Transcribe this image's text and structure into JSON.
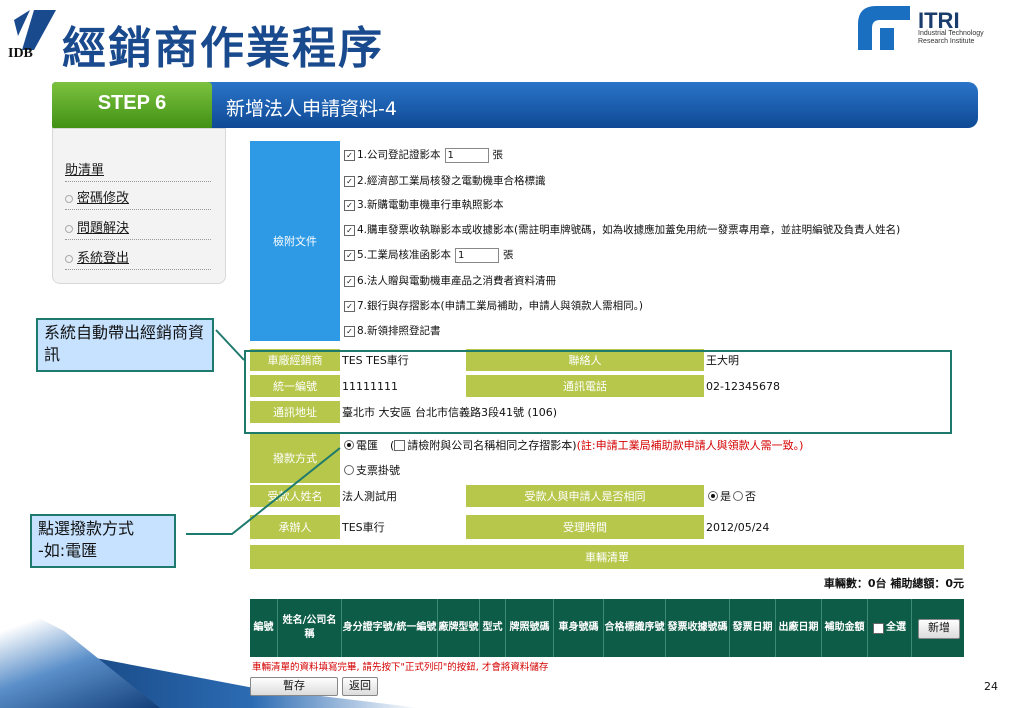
{
  "header": {
    "logo_text": "IDB",
    "title": "經銷商作業程序",
    "itri_name": "ITRI",
    "itri_sub": "Industrial Technology Research Institute"
  },
  "stepbar": {
    "step": "STEP 6",
    "title": "新增法人申請資料-4"
  },
  "menu": {
    "items": [
      "助清單",
      "密碼修改",
      "問題解決",
      "系統登出"
    ]
  },
  "attachments": {
    "label": "檢附文件",
    "lines": [
      {
        "text": "1.公司登記證影本",
        "input": "1",
        "suffix": "張"
      },
      {
        "text": "2.經濟部工業局核發之電動機車合格標識"
      },
      {
        "text": "3.新購電動車機車行車執照影本"
      },
      {
        "text": "4.購車發票收執聯影本或收據影本(需註明車牌號碼，如為收據應加蓋免用統一發票專用章，並註明編號及負責人姓名)"
      },
      {
        "text": "5.工業局核准函影本",
        "input": "1",
        "suffix": "張"
      },
      {
        "text": "6.法人贈與電動機車產品之消費者資料清冊"
      },
      {
        "text": "7.銀行與存摺影本(申請工業局補助，申請人與領款人需相同。)"
      },
      {
        "text": "8.新領排照登記書"
      }
    ]
  },
  "dealer": {
    "dealer_label": "車廠經銷商",
    "dealer_value": "TES TES車行",
    "contact_label": "聯絡人",
    "contact_value": "王大明",
    "tax_label": "統一編號",
    "tax_value": "11111111",
    "phone_label": "通訊電話",
    "phone_value": "02-12345678",
    "addr_label": "通訊地址",
    "addr_value": "臺北市 大安區 台北市信義路3段41號 (106)"
  },
  "payment": {
    "label": "撥款方式",
    "option1": "電匯",
    "option1_note": "(",
    "option1_check": "請檢附與公司名稱相同之存摺影本)",
    "option1_red": "(註:申請工業局補助款申請人與領款人需一致。)",
    "option2": "支票掛號"
  },
  "payee": {
    "name_label": "受款人姓名",
    "name_value": "法人測試用",
    "same_label": "受款人與申請人是否相同",
    "yes": "是",
    "no": "否"
  },
  "handler": {
    "label": "承辦人",
    "value": "TES車行",
    "time_label": "受理時間",
    "time_value": "2012/05/24"
  },
  "vehicle": {
    "section_title": "車輛清單",
    "summary": "車輛數：0台  補助總額：0元",
    "columns": [
      "編號",
      "姓名/公司名稱",
      "身分證字號/統一編號",
      "廠牌型號",
      "型式",
      "牌照號碼",
      "車身號碼",
      "合格標識序號",
      "發票收據號碼",
      "發票日期",
      "出廠日期",
      "補助金額",
      "全選"
    ],
    "add_button": "新增"
  },
  "footer": {
    "notice": "車輛清單的資料填寫完畢, 請先按下\"正式列印\"的按鈕, 才會將資料儲存",
    "save_button": "暫存",
    "back_button": "返回",
    "page_number": "24"
  },
  "callouts": {
    "auto_fill": "系統自動帶出經銷商資訊",
    "select_pay": "點選撥款方式\n-如:電匯"
  },
  "colors": {
    "label_green": "#b7c74c",
    "label_blue": "#2e9ae6",
    "table_header": "#0d5c47",
    "title_blue": "#1a4a8e"
  }
}
